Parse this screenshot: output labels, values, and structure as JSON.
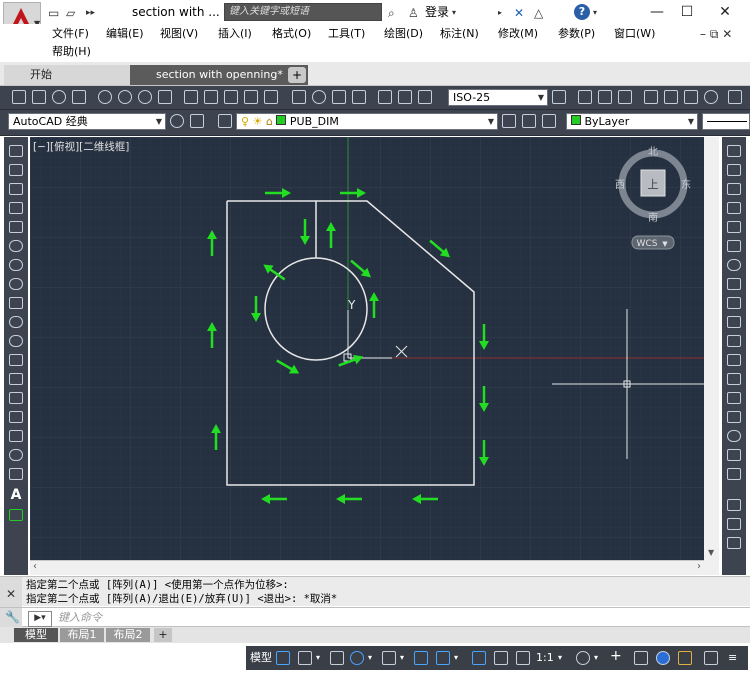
{
  "titlebar": {
    "title": "section with ...",
    "search_placeholder": "键入关键字或短语",
    "login": "登录",
    "help": "?"
  },
  "menu": {
    "items": [
      "文件(F)",
      "编辑(E)",
      "视图(V)",
      "插入(I)",
      "格式(O)",
      "工具(T)",
      "绘图(D)",
      "标注(N)",
      "修改(M)",
      "参数(P)",
      "窗口(W)",
      "帮助(H)"
    ]
  },
  "tabs": {
    "start": "开始",
    "document": "section with openning*",
    "add": "+"
  },
  "toolbar1": {
    "dim_style": "ISO-25"
  },
  "toolbar2": {
    "workspace": "AutoCAD 经典",
    "layer": "PUB_DIM",
    "color": "ByLayer"
  },
  "viewport": {
    "label": "[−][俯视][二维线框]",
    "compass": {
      "north": "北",
      "south": "南",
      "east": "东",
      "west": "西",
      "center": "上"
    },
    "wcs": "WCS",
    "axis_y": "Y"
  },
  "command": {
    "history": [
      "指定第二个点或 [阵列(A)] <使用第一个点作为位移>:",
      "指定第二个点或 [阵列(A)/退出(E)/放弃(U)] <退出>: *取消*"
    ],
    "placeholder": "键入命令"
  },
  "layout_tabs": [
    "模型",
    "布局1",
    "布局2",
    "+"
  ],
  "status": {
    "model": "模型",
    "scale": "1:1"
  },
  "colors": {
    "drawing_bg": "#253040",
    "arrow": "#22dd22",
    "toolbar": "#3d4450",
    "autocad_red": "#c0161b"
  }
}
